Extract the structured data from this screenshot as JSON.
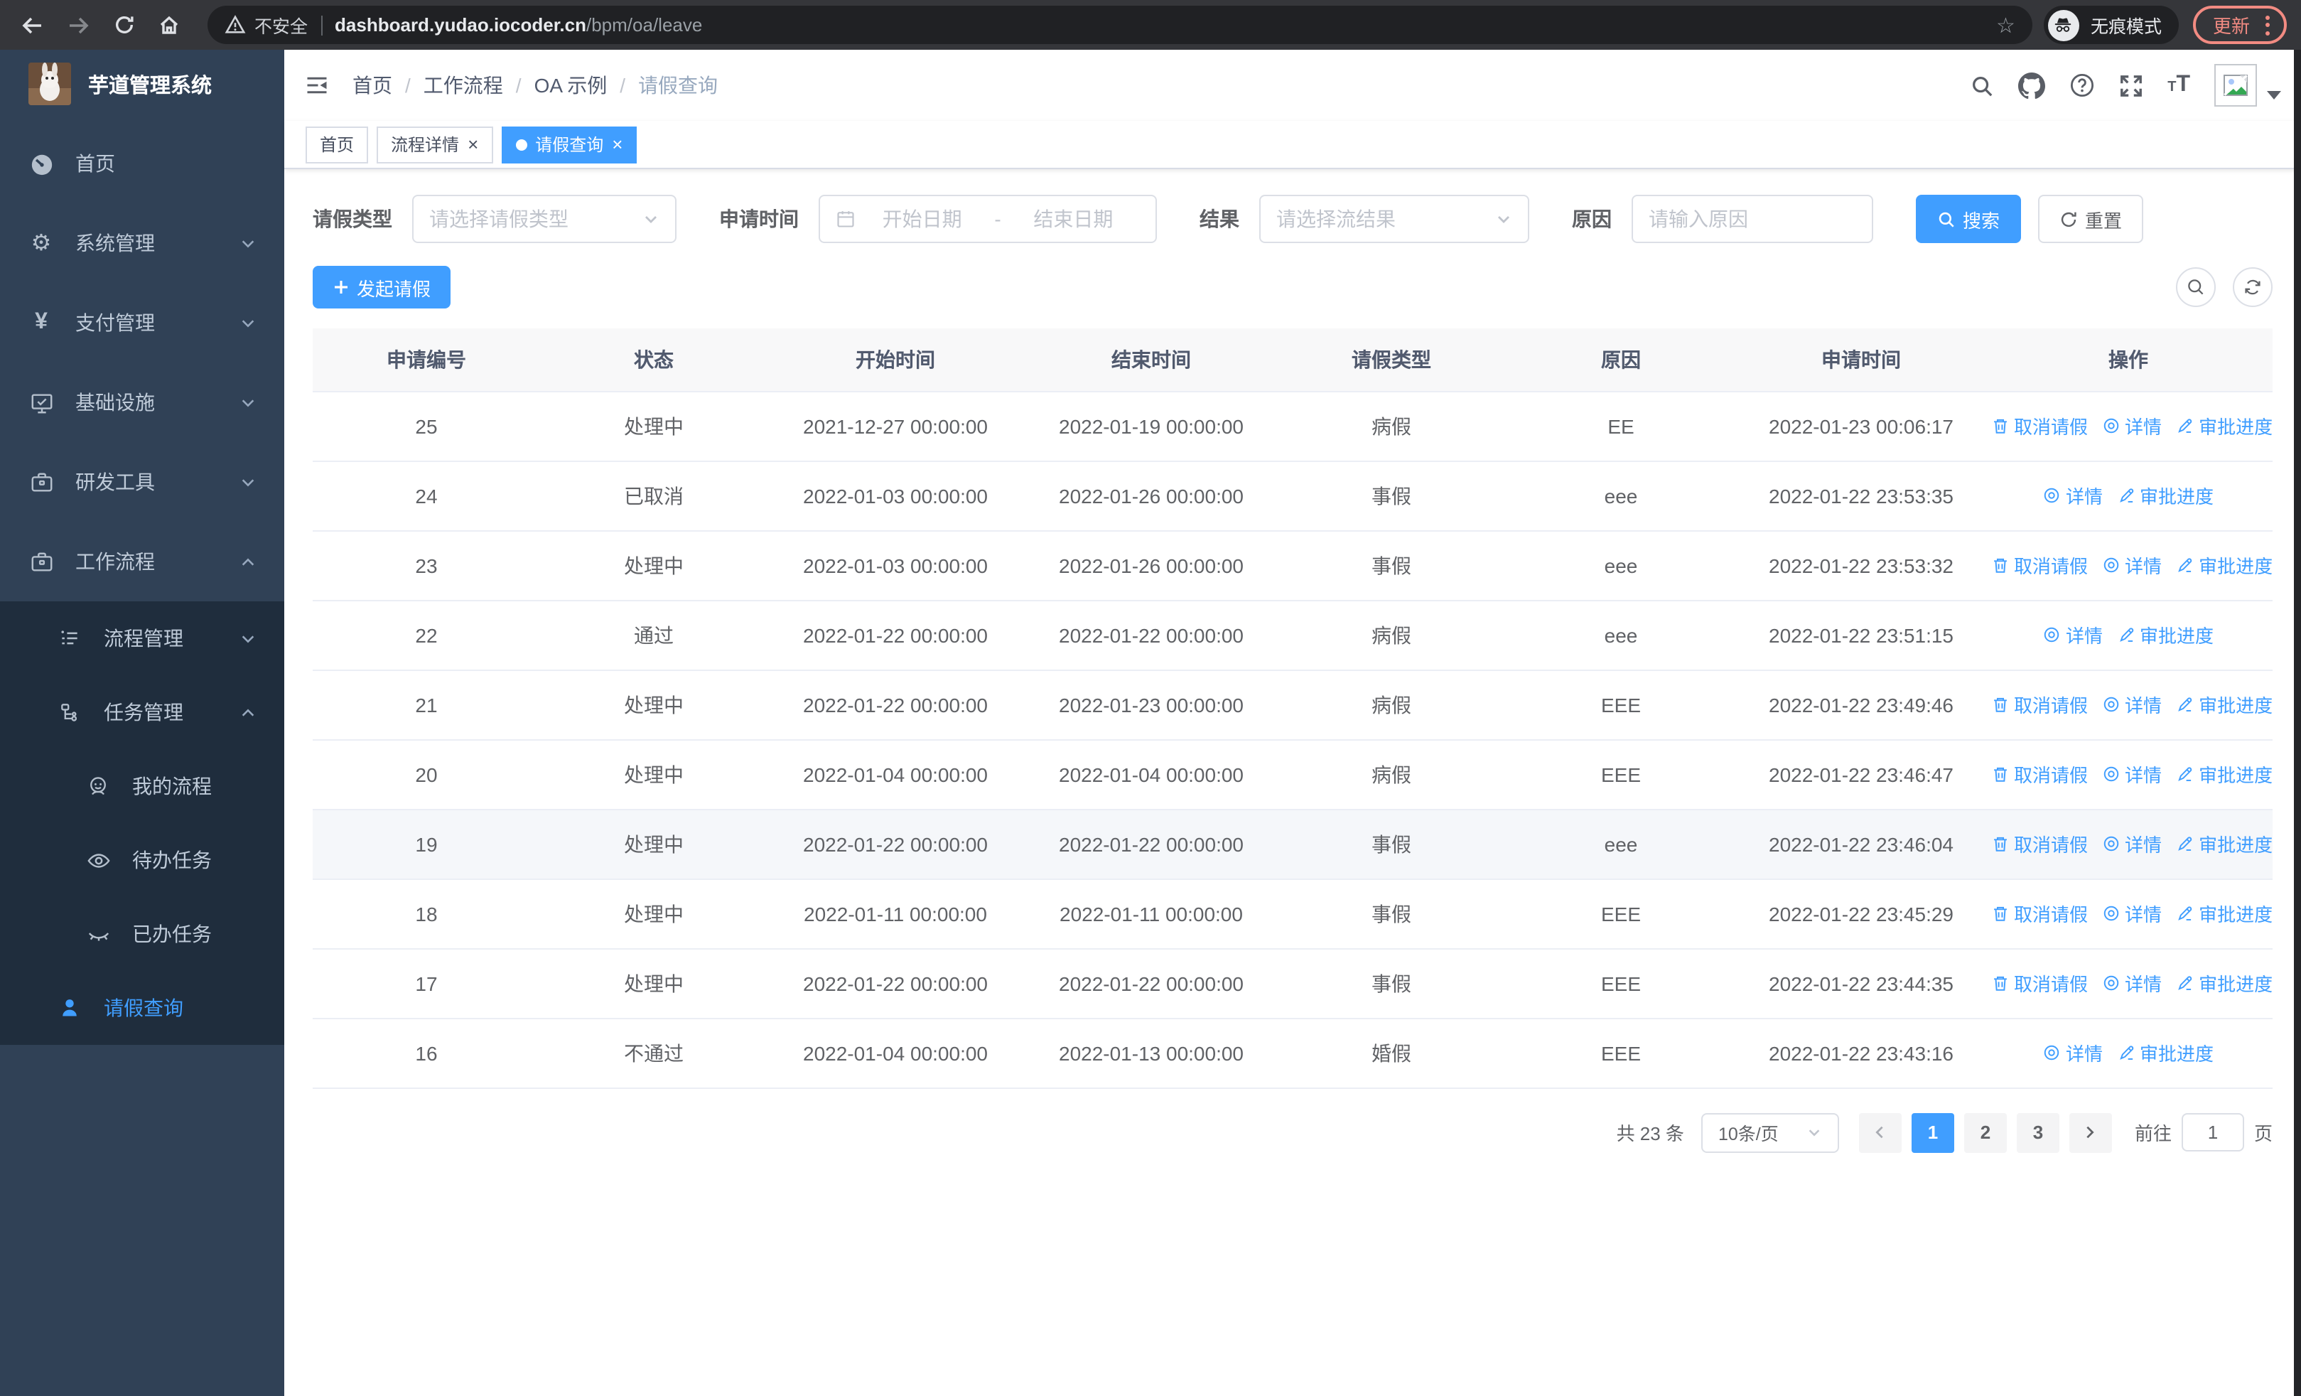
{
  "colors": {
    "accent": "#409eff",
    "sidebar_bg": "#304156",
    "submenu_bg": "#1f2d3d",
    "update_pill": "#f28b82",
    "link_blue": "#409eff"
  },
  "browser": {
    "security_label": "不安全",
    "url_host": "dashboard.yudao.iocoder.cn",
    "url_path": "/bpm/oa/leave",
    "incognito_label": "无痕模式",
    "update_label": "更新"
  },
  "sidebar": {
    "title": "芋道管理系统",
    "items": [
      {
        "label": "首页"
      },
      {
        "label": "系统管理"
      },
      {
        "label": "支付管理"
      },
      {
        "label": "基础设施"
      },
      {
        "label": "研发工具"
      },
      {
        "label": "工作流程"
      },
      {
        "label": "流程管理"
      },
      {
        "label": "任务管理"
      },
      {
        "label": "我的流程"
      },
      {
        "label": "待办任务"
      },
      {
        "label": "已办任务"
      },
      {
        "label": "请假查询"
      }
    ]
  },
  "breadcrumb": {
    "separator": "/",
    "items": [
      "首页",
      "工作流程",
      "OA 示例",
      "请假查询"
    ]
  },
  "tabs": {
    "close_glyph": "×",
    "items": [
      {
        "label": "首页"
      },
      {
        "label": "流程详情"
      },
      {
        "label": "请假查询"
      }
    ]
  },
  "filters": {
    "leave_type_label": "请假类型",
    "leave_type_placeholder": "请选择请假类型",
    "apply_time_label": "申请时间",
    "date_start_placeholder": "开始日期",
    "date_separator": "-",
    "date_end_placeholder": "结束日期",
    "result_label": "结果",
    "result_placeholder": "请选择流结果",
    "reason_label": "原因",
    "reason_placeholder": "请输入原因",
    "search_label": "搜索",
    "reset_label": "重置"
  },
  "toolbar": {
    "create_label": "发起请假"
  },
  "table": {
    "columns": [
      "申请编号",
      "状态",
      "开始时间",
      "结束时间",
      "请假类型",
      "原因",
      "申请时间",
      "操作"
    ],
    "action_labels": {
      "cancel": "取消请假",
      "detail": "详情",
      "progress": "审批进度"
    },
    "rows": [
      {
        "id": "25",
        "status": "处理中",
        "start": "2021-12-27 00:00:00",
        "end": "2022-01-19 00:00:00",
        "type": "病假",
        "reason": "EE",
        "apply_time": "2022-01-23 00:06:17",
        "actions": [
          "cancel",
          "detail",
          "progress"
        ],
        "highlight": false
      },
      {
        "id": "24",
        "status": "已取消",
        "start": "2022-01-03 00:00:00",
        "end": "2022-01-26 00:00:00",
        "type": "事假",
        "reason": "eee",
        "apply_time": "2022-01-22 23:53:35",
        "actions": [
          "detail",
          "progress"
        ],
        "highlight": false
      },
      {
        "id": "23",
        "status": "处理中",
        "start": "2022-01-03 00:00:00",
        "end": "2022-01-26 00:00:00",
        "type": "事假",
        "reason": "eee",
        "apply_time": "2022-01-22 23:53:32",
        "actions": [
          "cancel",
          "detail",
          "progress"
        ],
        "highlight": false
      },
      {
        "id": "22",
        "status": "通过",
        "start": "2022-01-22 00:00:00",
        "end": "2022-01-22 00:00:00",
        "type": "病假",
        "reason": "eee",
        "apply_time": "2022-01-22 23:51:15",
        "actions": [
          "detail",
          "progress"
        ],
        "highlight": false
      },
      {
        "id": "21",
        "status": "处理中",
        "start": "2022-01-22 00:00:00",
        "end": "2022-01-23 00:00:00",
        "type": "病假",
        "reason": "EEE",
        "apply_time": "2022-01-22 23:49:46",
        "actions": [
          "cancel",
          "detail",
          "progress"
        ],
        "highlight": false
      },
      {
        "id": "20",
        "status": "处理中",
        "start": "2022-01-04 00:00:00",
        "end": "2022-01-04 00:00:00",
        "type": "病假",
        "reason": "EEE",
        "apply_time": "2022-01-22 23:46:47",
        "actions": [
          "cancel",
          "detail",
          "progress"
        ],
        "highlight": false
      },
      {
        "id": "19",
        "status": "处理中",
        "start": "2022-01-22 00:00:00",
        "end": "2022-01-22 00:00:00",
        "type": "事假",
        "reason": "eee",
        "apply_time": "2022-01-22 23:46:04",
        "actions": [
          "cancel",
          "detail",
          "progress"
        ],
        "highlight": true
      },
      {
        "id": "18",
        "status": "处理中",
        "start": "2022-01-11 00:00:00",
        "end": "2022-01-11 00:00:00",
        "type": "事假",
        "reason": "EEE",
        "apply_time": "2022-01-22 23:45:29",
        "actions": [
          "cancel",
          "detail",
          "progress"
        ],
        "highlight": false
      },
      {
        "id": "17",
        "status": "处理中",
        "start": "2022-01-22 00:00:00",
        "end": "2022-01-22 00:00:00",
        "type": "事假",
        "reason": "EEE",
        "apply_time": "2022-01-22 23:44:35",
        "actions": [
          "cancel",
          "detail",
          "progress"
        ],
        "highlight": false
      },
      {
        "id": "16",
        "status": "不通过",
        "start": "2022-01-04 00:00:00",
        "end": "2022-01-13 00:00:00",
        "type": "婚假",
        "reason": "EEE",
        "apply_time": "2022-01-22 23:43:16",
        "actions": [
          "detail",
          "progress"
        ],
        "highlight": false
      }
    ]
  },
  "pagination": {
    "total_label": "共 23 条",
    "page_size": "10条/页",
    "pages": [
      "1",
      "2",
      "3"
    ],
    "active_page": "1",
    "goto_label": "前往",
    "goto_value": "1",
    "page_suffix": "页"
  }
}
